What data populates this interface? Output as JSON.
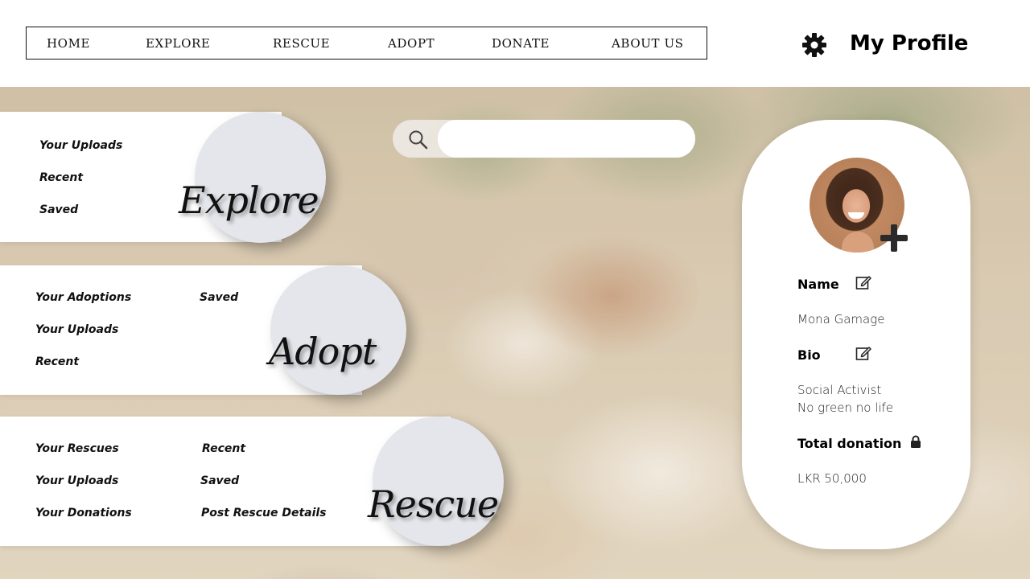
{
  "nav": {
    "items": [
      "HOME",
      "EXPLORE",
      "RESCUE",
      "ADOPT",
      "DONATE",
      "ABOUT US"
    ]
  },
  "profile_header": {
    "title": "My Profile",
    "icon": "gear-icon"
  },
  "search": {
    "placeholder": "",
    "value": "",
    "icon": "search-icon"
  },
  "explore_panel": {
    "title": "Explore",
    "links": [
      "Your Uploads",
      "Recent",
      "Saved"
    ]
  },
  "adopt_panel": {
    "title": "Adopt",
    "links_col1": [
      "Your Adoptions",
      "Your Uploads",
      "Recent"
    ],
    "links_col2": [
      "Saved"
    ]
  },
  "rescue_panel": {
    "title": "Rescue",
    "links_col1": [
      "Your Rescues",
      "Your Uploads",
      "Your Donations"
    ],
    "links_col2": [
      "Recent",
      "Saved",
      "Post Rescue Details"
    ]
  },
  "profile_card": {
    "name_label": "Name",
    "name_value": "Mona Gamage",
    "bio_label": "Bio",
    "bio_line1": "Social Activist",
    "bio_line2": "No green no life",
    "donation_label": "Total donation",
    "donation_value": "LKR 50,000"
  },
  "colors": {
    "circle": "#e5e6eb",
    "text": "#111111",
    "card": "#ffffff"
  }
}
